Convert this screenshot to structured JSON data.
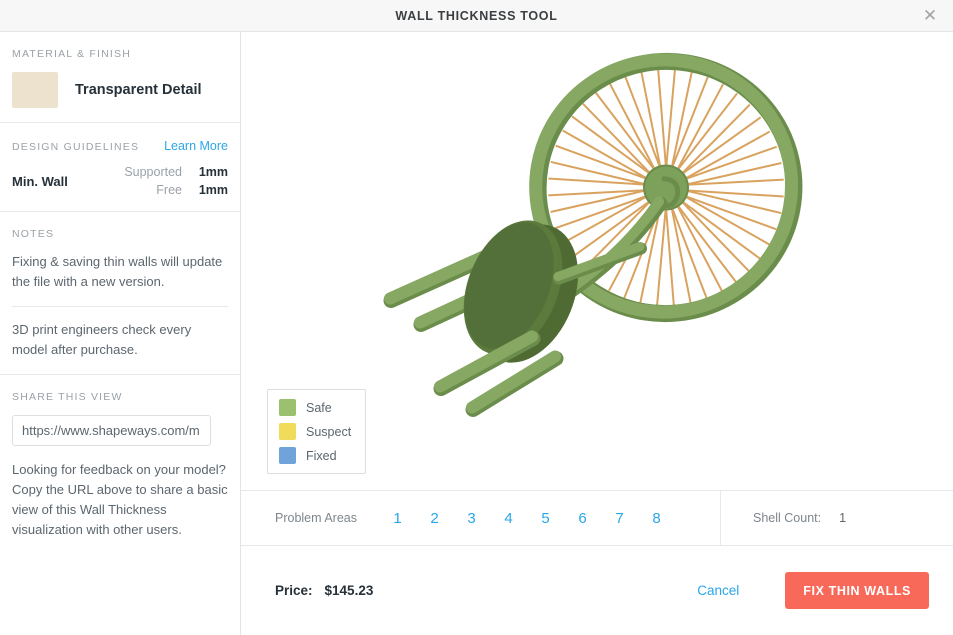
{
  "header": {
    "title": "WALL THICKNESS TOOL",
    "close_icon": "close-icon",
    "close_glyph": "✕"
  },
  "sidebar": {
    "material": {
      "section_title": "MATERIAL & FINISH",
      "name": "Transparent Detail",
      "swatch_color": "#ede2cd"
    },
    "guidelines": {
      "section_title": "DESIGN GUIDELINES",
      "learn_more": "Learn More",
      "row_label": "Min. Wall",
      "rows": [
        {
          "key": "Supported",
          "value": "1mm"
        },
        {
          "key": "Free",
          "value": "1mm"
        }
      ]
    },
    "notes": {
      "section_title": "NOTES",
      "paragraphs": [
        "Fixing & saving thin walls will update the file with a new version.",
        "3D print engineers check every model after purchase."
      ]
    },
    "share": {
      "section_title": "SHARE THIS VIEW",
      "url_value": "https://www.shapeways.com/m",
      "url_placeholder": "https://www.shapeways.com/m",
      "description": "Looking for feedback on your model? Copy the URL above to share a basic view of this Wall Thickness visualization with other users."
    }
  },
  "viewer": {
    "legend": {
      "items": [
        {
          "label": "Safe",
          "color": "#9bc06e"
        },
        {
          "label": "Suspect",
          "color": "#f0dc5a"
        },
        {
          "label": "Fixed",
          "color": "#6fa3d9"
        }
      ]
    },
    "model": {
      "rim_color": "#7da05a",
      "rim_shade_color": "#6b8d4b",
      "spoke_color": "#d9a25e",
      "hub_color": "#7da05a",
      "disc_color": "#4f6b33",
      "leg_color": "#7da05a"
    }
  },
  "problem_bar": {
    "label": "Problem Areas",
    "numbers": [
      "1",
      "2",
      "3",
      "4",
      "5",
      "6",
      "7",
      "8"
    ],
    "shell_count_label": "Shell Count:",
    "shell_count_value": "1"
  },
  "footer": {
    "price_label": "Price:",
    "price_value": "$145.23",
    "cancel_label": "Cancel",
    "fix_label": "Fix Thin Walls",
    "fix_color": "#f9695a"
  }
}
